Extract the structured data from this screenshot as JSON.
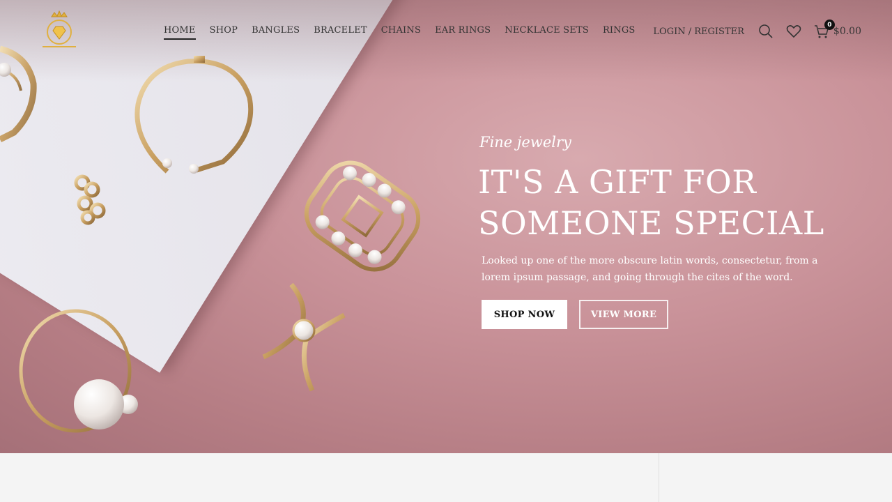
{
  "header": {
    "nav": [
      "HOME",
      "SHOP",
      "BANGLES",
      "BRACELET",
      "CHAINS",
      "EAR RINGS",
      "NECKLACE SETS",
      "RINGS"
    ],
    "active_index": 0,
    "login_label": "LOGIN / REGISTER",
    "cart_count": "0",
    "cart_total": "$0.00",
    "icons": [
      "logo-crown-diamond",
      "search-icon",
      "heart-icon",
      "cart-icon"
    ]
  },
  "hero": {
    "eyebrow": "Fine jewelry",
    "headline_line1": "IT'S A GIFT FOR",
    "headline_line2": "SOMEONE SPECIAL",
    "description": "Looked up one of the more obscure latin words, consectetur, from a lorem ipsum passage, and going through the cites of the word.",
    "primary_button": "SHOP NOW",
    "secondary_button": "VIEW MORE"
  },
  "colors": {
    "hero_bg": "#c99299",
    "slab": "#ecebf0",
    "gold": "#d9b77e",
    "text_dark": "#333333",
    "white": "#ffffff"
  }
}
